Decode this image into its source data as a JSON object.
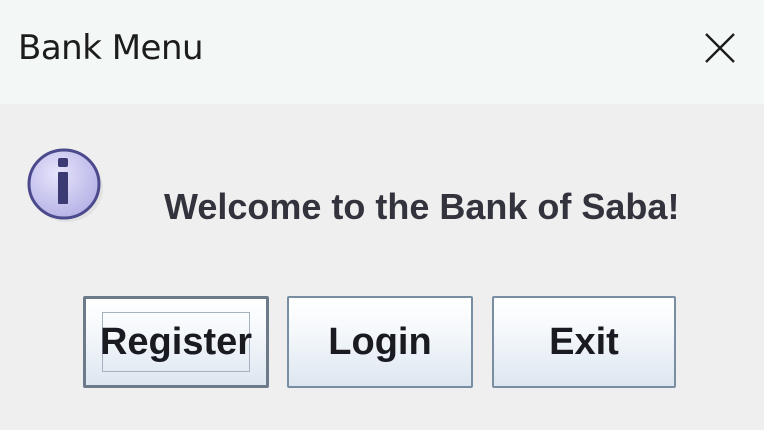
{
  "window": {
    "title": "Bank Menu"
  },
  "dialog": {
    "icon": "info-icon",
    "message": "Welcome to the Bank of Saba!",
    "buttons": [
      {
        "label": "Register",
        "default": true
      },
      {
        "label": "Login"
      },
      {
        "label": "Exit"
      }
    ]
  },
  "colors": {
    "background": "#efefef",
    "titlebar": "#f3f7f6",
    "message_text": "#33333d",
    "icon_fill": "#c9c6ef",
    "icon_stroke": "#4b4a8c",
    "button_border": "#7a8ea3"
  }
}
